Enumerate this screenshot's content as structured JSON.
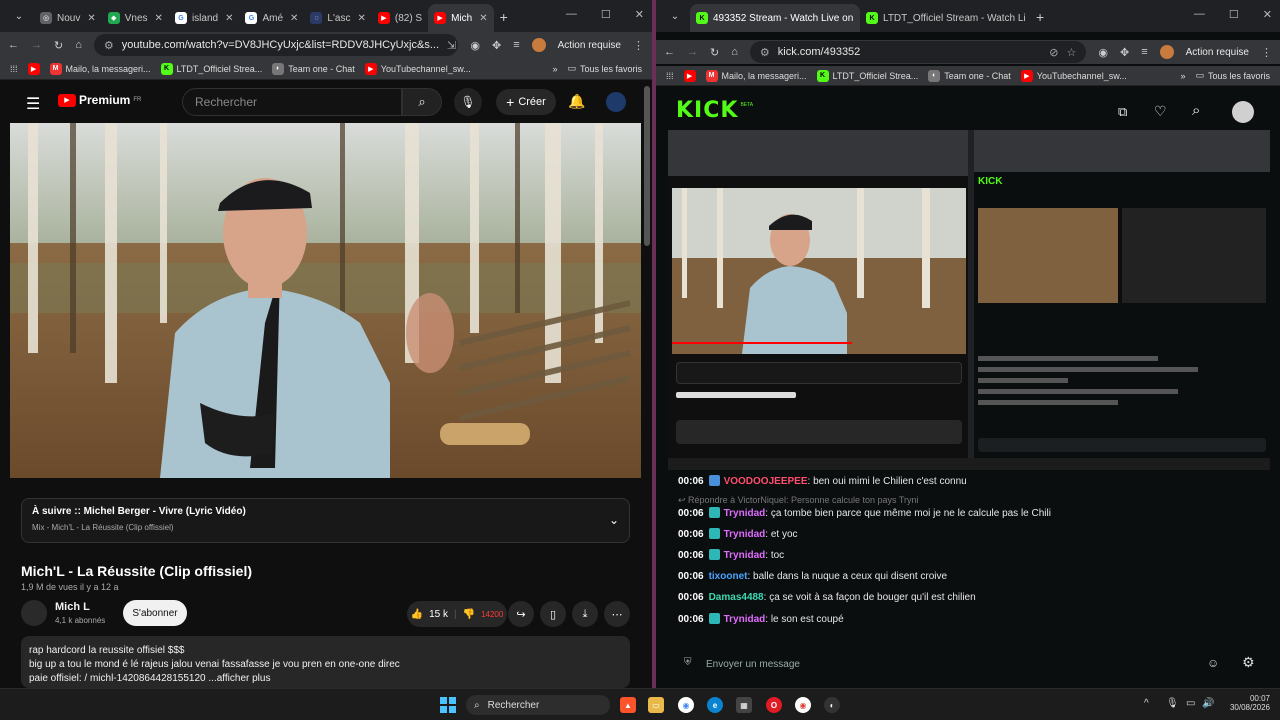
{
  "left_browser": {
    "tabs": [
      "Nouv",
      "Vnes",
      "island",
      "Amé",
      "L'asc",
      "(82) S",
      "Mich"
    ],
    "url": "youtube.com/watch?v=DV8JHCyUxjc&list=RDDV8JHCyUxjc&s...",
    "action_required": "Action requise",
    "bookmarks": [
      "Mailo, la messageri...",
      "LTDT_Officiel Strea...",
      "Team one - Chat",
      "YouTubechannel_sw..."
    ],
    "all_bookmarks": "Tous les favoris"
  },
  "youtube": {
    "logo": "Premium",
    "logo_sup": "FR",
    "search_placeholder": "Rechercher",
    "create_label": "Créer",
    "up_next_title": "À suivre :: Michel Berger - Vivre (Lyric Vidéo)",
    "up_next_sub": "Mix - Mich'L - La Réussite (Clip offissiel)",
    "video_title": "Mich'L - La Réussite (Clip offissiel)",
    "views": "1,9 M de vues  il y a 12 a",
    "channel": "Mich L",
    "subscribers": "4,1 k abonnés",
    "subscribe_label": "S'abonner",
    "likes": "15 k",
    "dislikes": "14200",
    "desc_line1": "rap hardcord la reussite offisiel $$$",
    "desc_line2": "big up a tou le mond é lé rajeus jalou venai fassafasse je vou pren en one-one direc",
    "desc_line3": "paie offisiel:   / michl-1420864428155120   ...afficher plus"
  },
  "right_browser": {
    "tabs": [
      "493352 Stream - Watch Live on",
      "LTDT_Officiel Stream - Watch Li"
    ],
    "url": "kick.com/493352",
    "action_required": "Action requise",
    "bookmarks": [
      "Mailo, la messageri...",
      "LTDT_Officiel Strea...",
      "Team one - Chat",
      "YouTubechannel_sw..."
    ],
    "all_bookmarks": "Tous les favoris"
  },
  "kick": {
    "logo": "KICK",
    "logo_sup": "BETA",
    "chat": [
      {
        "time": "00:06",
        "user": "VOODOOJEEPEE",
        "color": "#ff4d6d",
        "badge": "#4a90d9",
        "text": "ben oui mimi le Chilien c'est connu"
      },
      {
        "time": "00:06",
        "user": "Trynidad",
        "color": "#e06cff",
        "badge": "#2fb6b6",
        "text": "ça tombe bien parce que même moi je ne le calcule pas le Chili"
      },
      {
        "time": "00:06",
        "user": "Trynidad",
        "color": "#e06cff",
        "badge": "#2fb6b6",
        "text": "et yoc"
      },
      {
        "time": "00:06",
        "user": "Trynidad",
        "color": "#e06cff",
        "badge": "#2fb6b6",
        "text": "toc"
      },
      {
        "time": "00:06",
        "user": "tixoonet",
        "color": "#4aa3ff",
        "badge": "",
        "text": "balle dans la nuque a ceux qui disent croive"
      },
      {
        "time": "00:06",
        "user": "Damas4488",
        "color": "#3fd9b0",
        "badge": "",
        "text": "ça se voit à sa façon de bouger qu'il est chilien"
      },
      {
        "time": "00:06",
        "user": "Trynidad",
        "color": "#e06cff",
        "badge": "#2fb6b6",
        "text": "le son est coupé"
      }
    ],
    "reply_note": "Répondre à VictorNiquel: Personne calcule ton pays Tryni",
    "chat_placeholder": "Envoyer un message"
  },
  "taskbar": {
    "search": "Rechercher",
    "time": "00:07",
    "date": "30/08/2026"
  },
  "colors": {
    "kick_green": "#53fc18",
    "yt_red": "#ff0000",
    "bg": "#0f0f0f"
  }
}
